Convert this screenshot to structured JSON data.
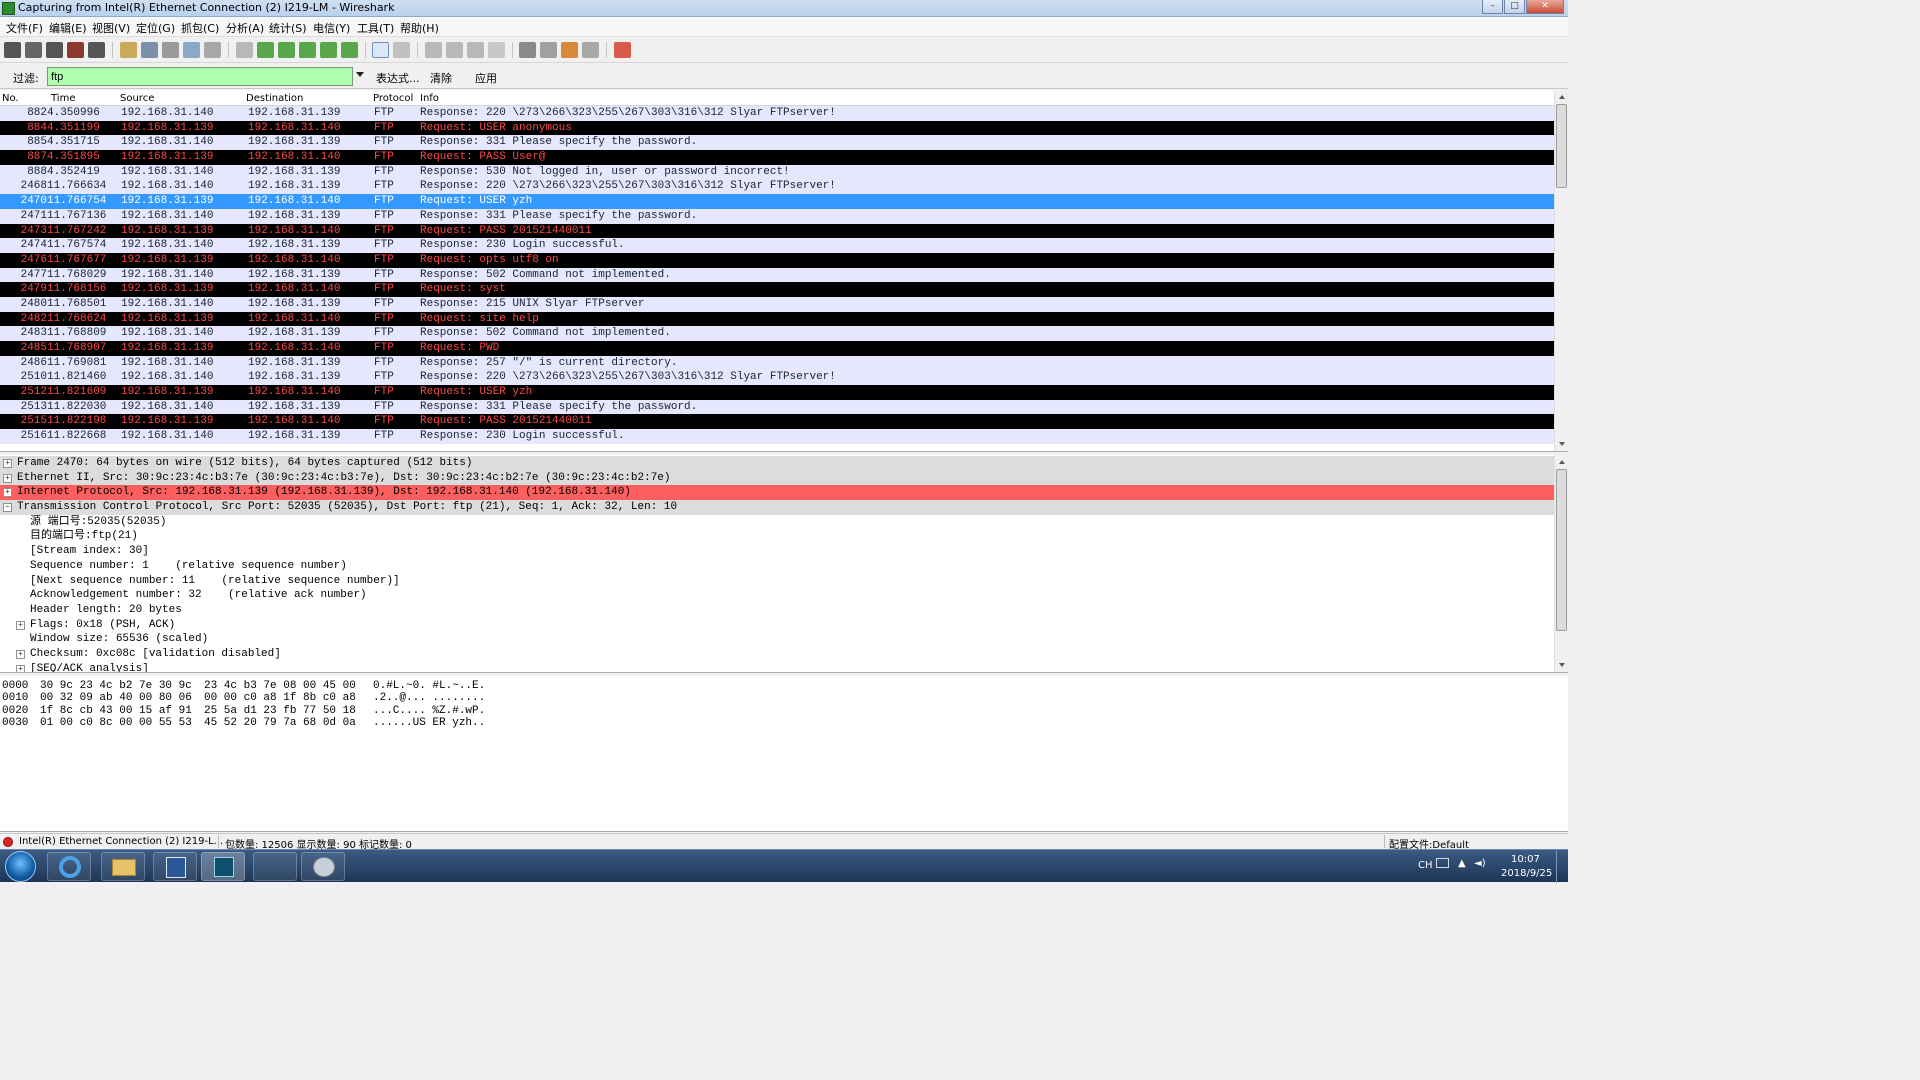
{
  "window": {
    "title": "Capturing from Intel(R) Ethernet Connection (2) I219-LM - Wireshark"
  },
  "menu": [
    "文件(F)",
    "编辑(E)",
    "视图(V)",
    "定位(G)",
    "抓包(C)",
    "分析(A)",
    "统计(S)",
    "电信(Y)",
    "工具(T)",
    "帮助(H)"
  ],
  "filter": {
    "label": "过滤:",
    "value": "ftp",
    "expression_label": "表达式...",
    "clear_label": "清除",
    "apply_label": "应用"
  },
  "packet_list": {
    "columns": [
      "No.",
      "Time",
      "Source",
      "Destination",
      "Protocol",
      "Info"
    ],
    "rows": [
      {
        "no": "882",
        "time": "4.350996",
        "src": "192.168.31.140",
        "dst": "192.168.31.139",
        "proto": "FTP",
        "info": "Response: 220 \\273\\266\\323\\255\\267\\303\\316\\312 Slyar FTPserver!",
        "type": "resp"
      },
      {
        "no": "884",
        "time": "4.351199",
        "src": "192.168.31.139",
        "dst": "192.168.31.140",
        "proto": "FTP",
        "info": "Request: USER anonymous",
        "type": "req"
      },
      {
        "no": "885",
        "time": "4.351715",
        "src": "192.168.31.140",
        "dst": "192.168.31.139",
        "proto": "FTP",
        "info": "Response: 331 Please specify the password.",
        "type": "resp"
      },
      {
        "no": "887",
        "time": "4.351895",
        "src": "192.168.31.139",
        "dst": "192.168.31.140",
        "proto": "FTP",
        "info": "Request: PASS User@",
        "type": "req"
      },
      {
        "no": "888",
        "time": "4.352419",
        "src": "192.168.31.140",
        "dst": "192.168.31.139",
        "proto": "FTP",
        "info": "Response: 530 Not logged in, user or password incorrect!",
        "type": "resp"
      },
      {
        "no": "2468",
        "time": "11.766634",
        "src": "192.168.31.140",
        "dst": "192.168.31.139",
        "proto": "FTP",
        "info": "Response: 220 \\273\\266\\323\\255\\267\\303\\316\\312 Slyar FTPserver!",
        "type": "resp"
      },
      {
        "no": "2470",
        "time": "11.766754",
        "src": "192.168.31.139",
        "dst": "192.168.31.140",
        "proto": "FTP",
        "info": "Request: USER yzh",
        "type": "sel"
      },
      {
        "no": "2471",
        "time": "11.767136",
        "src": "192.168.31.140",
        "dst": "192.168.31.139",
        "proto": "FTP",
        "info": "Response: 331 Please specify the password.",
        "type": "resp"
      },
      {
        "no": "2473",
        "time": "11.767242",
        "src": "192.168.31.139",
        "dst": "192.168.31.140",
        "proto": "FTP",
        "info": "Request: PASS 201521440011",
        "type": "req"
      },
      {
        "no": "2474",
        "time": "11.767574",
        "src": "192.168.31.140",
        "dst": "192.168.31.139",
        "proto": "FTP",
        "info": "Response: 230 Login successful.",
        "type": "resp"
      },
      {
        "no": "2476",
        "time": "11.767677",
        "src": "192.168.31.139",
        "dst": "192.168.31.140",
        "proto": "FTP",
        "info": "Request: opts utf8 on",
        "type": "req"
      },
      {
        "no": "2477",
        "time": "11.768029",
        "src": "192.168.31.140",
        "dst": "192.168.31.139",
        "proto": "FTP",
        "info": "Response: 502 Command not implemented.",
        "type": "resp"
      },
      {
        "no": "2479",
        "time": "11.768156",
        "src": "192.168.31.139",
        "dst": "192.168.31.140",
        "proto": "FTP",
        "info": "Request: syst",
        "type": "req"
      },
      {
        "no": "2480",
        "time": "11.768501",
        "src": "192.168.31.140",
        "dst": "192.168.31.139",
        "proto": "FTP",
        "info": "Response: 215 UNIX Slyar FTPserver",
        "type": "resp"
      },
      {
        "no": "2482",
        "time": "11.768624",
        "src": "192.168.31.139",
        "dst": "192.168.31.140",
        "proto": "FTP",
        "info": "Request: site help",
        "type": "req"
      },
      {
        "no": "2483",
        "time": "11.768809",
        "src": "192.168.31.140",
        "dst": "192.168.31.139",
        "proto": "FTP",
        "info": "Response: 502 Command not implemented.",
        "type": "resp"
      },
      {
        "no": "2485",
        "time": "11.768907",
        "src": "192.168.31.139",
        "dst": "192.168.31.140",
        "proto": "FTP",
        "info": "Request: PWD",
        "type": "req"
      },
      {
        "no": "2486",
        "time": "11.769081",
        "src": "192.168.31.140",
        "dst": "192.168.31.139",
        "proto": "FTP",
        "info": "Response: 257 \"/\" is current directory.",
        "type": "resp"
      },
      {
        "no": "2510",
        "time": "11.821460",
        "src": "192.168.31.140",
        "dst": "192.168.31.139",
        "proto": "FTP",
        "info": "Response: 220 \\273\\266\\323\\255\\267\\303\\316\\312 Slyar FTPserver!",
        "type": "resp"
      },
      {
        "no": "2512",
        "time": "11.821609",
        "src": "192.168.31.139",
        "dst": "192.168.31.140",
        "proto": "FTP",
        "info": "Request: USER yzh",
        "type": "req"
      },
      {
        "no": "2513",
        "time": "11.822030",
        "src": "192.168.31.140",
        "dst": "192.168.31.139",
        "proto": "FTP",
        "info": "Response: 331 Please specify the password.",
        "type": "resp"
      },
      {
        "no": "2515",
        "time": "11.822198",
        "src": "192.168.31.139",
        "dst": "192.168.31.140",
        "proto": "FTP",
        "info": "Request: PASS 201521440011",
        "type": "req"
      },
      {
        "no": "2516",
        "time": "11.822668",
        "src": "192.168.31.140",
        "dst": "192.168.31.139",
        "proto": "FTP",
        "info": "Response: 230 Login successful.",
        "type": "resp"
      }
    ]
  },
  "details": [
    {
      "text": "Frame 2470: 64 bytes on wire (512 bits), 64 bytes captured (512 bits)",
      "level": 0,
      "expander": "+",
      "hl": "grey"
    },
    {
      "text": "Ethernet II, Src: 30:9c:23:4c:b3:7e (30:9c:23:4c:b3:7e), Dst: 30:9c:23:4c:b2:7e (30:9c:23:4c:b2:7e)",
      "level": 0,
      "expander": "+",
      "hl": "grey"
    },
    {
      "text": "Internet Protocol, Src: 192.168.31.139 (192.168.31.139), Dst: 192.168.31.140 (192.168.31.140)",
      "level": 0,
      "expander": "+",
      "hl": "red"
    },
    {
      "text": "Transmission Control Protocol, Src Port: 52035 (52035), Dst Port: ftp (21), Seq: 1, Ack: 32, Len: 10",
      "level": 0,
      "expander": "-",
      "hl": "grey"
    },
    {
      "text": "源 端口号:52035(52035)",
      "level": 1,
      "expander": "",
      "hl": ""
    },
    {
      "text": "目的端口号:ftp(21)",
      "level": 1,
      "expander": "",
      "hl": ""
    },
    {
      "text": "[Stream index: 30]",
      "level": 1,
      "expander": "",
      "hl": ""
    },
    {
      "text": "Sequence number: 1    (relative sequence number)",
      "level": 1,
      "expander": "",
      "hl": ""
    },
    {
      "text": "[Next sequence number: 11    (relative sequence number)]",
      "level": 1,
      "expander": "",
      "hl": ""
    },
    {
      "text": "Acknowledgement number: 32    (relative ack number)",
      "level": 1,
      "expander": "",
      "hl": ""
    },
    {
      "text": "Header length: 20 bytes",
      "level": 1,
      "expander": "",
      "hl": ""
    },
    {
      "text": "Flags: 0x18 (PSH, ACK)",
      "level": 1,
      "expander": "+",
      "hl": ""
    },
    {
      "text": "Window size: 65536 (scaled)",
      "level": 1,
      "expander": "",
      "hl": ""
    },
    {
      "text": "Checksum: 0xc08c [validation disabled]",
      "level": 1,
      "expander": "+",
      "hl": ""
    },
    {
      "text": "[SEQ/ACK analysis]",
      "level": 1,
      "expander": "+",
      "hl": ""
    }
  ],
  "bytes": [
    {
      "offset": "0000",
      "hex1": "30 9c 23 4c b2 7e 30 9c",
      "hex2": "23 4c b3 7e 08 00 45 00",
      "ascii": "0.#L.~0. #L.~..E."
    },
    {
      "offset": "0010",
      "hex1": "00 32 09 ab 40 00 80 06",
      "hex2": "00 00 c0 a8 1f 8b c0 a8",
      "ascii": ".2..@... ........"
    },
    {
      "offset": "0020",
      "hex1": "1f 8c cb 43 00 15 af 91",
      "hex2": "25 5a d1 23 fb 77 50 18",
      "ascii": "...C.... %Z.#.wP."
    },
    {
      "offset": "0030",
      "hex1": "01 00 c0 8c 00 00 55 53",
      "hex2": "45 52 20 79 7a 68 0d 0a",
      "ascii": "......US ER yzh.."
    }
  ],
  "status": {
    "interface": "Intel(R) Ethernet Connection (2) I219-L...",
    "counts": "包数量: 12506 显示数量: 90 标记数量: 0",
    "profile": "配置文件:Default"
  },
  "taskbar": {
    "lang": "CH",
    "time": "10:07",
    "date": "2018/9/25"
  }
}
